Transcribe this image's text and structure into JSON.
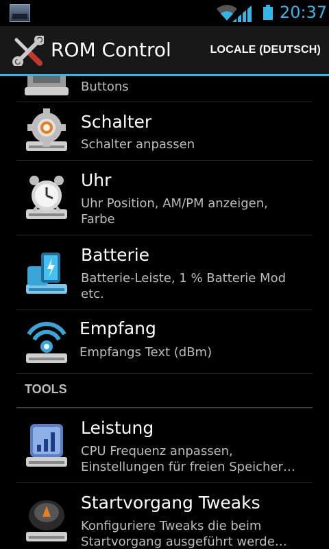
{
  "status_bar": {
    "time": "20:37",
    "icons": [
      "gallery-thumbnail-icon",
      "wifi-icon",
      "signal-icon",
      "battery-icon"
    ]
  },
  "action_bar": {
    "title": "ROM Control",
    "app_icon": "tools-icon",
    "action_label": "LOCALE (DEUTSCH)"
  },
  "list": {
    "items_before": [
      {
        "title": "",
        "subtitle": "Buttons",
        "icon": "buttons-icon"
      },
      {
        "title": "Schalter",
        "subtitle": "Schalter anpassen",
        "icon": "gear-icon"
      },
      {
        "title": "Uhr",
        "subtitle": "Uhr Position, AM/PM anzeigen, Farbe",
        "icon": "alarm-clock-icon"
      },
      {
        "title": "Batterie",
        "subtitle": "Batterie-Leiste, 1 % Batterie Mod etc.",
        "icon": "battery-charging-icon"
      },
      {
        "title": "Empfang",
        "subtitle": "Empfangs Text (dBm)",
        "icon": "wifi-signal-icon"
      }
    ],
    "section": "TOOLS",
    "items_after": [
      {
        "title": "Leistung",
        "subtitle": "CPU Frequenz anpassen, Einstellungen für freien Speicher…",
        "icon": "performance-chart-icon"
      },
      {
        "title": "Startvorgang Tweaks",
        "subtitle": "Konfiguriere Tweaks die beim Startvorgang ausgeführt werde…",
        "icon": "boot-tweaks-icon"
      }
    ]
  },
  "colors": {
    "accent": "#33b5e5",
    "background": "#000000",
    "action_bar": "#181818"
  }
}
